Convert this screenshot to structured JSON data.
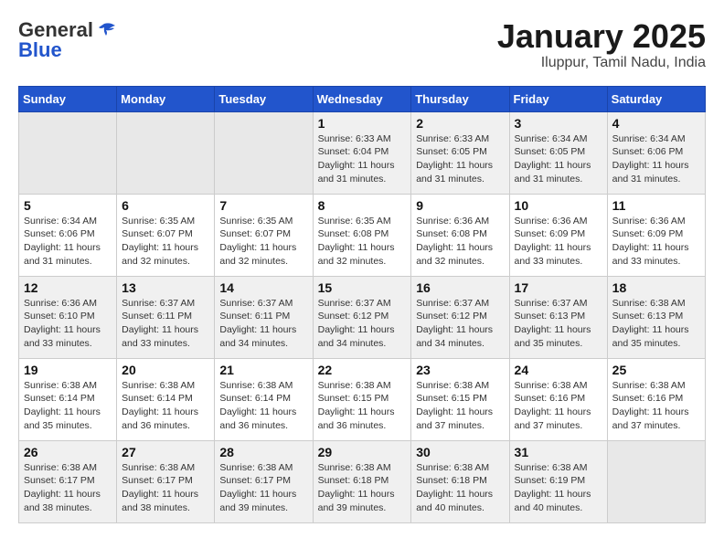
{
  "header": {
    "logo_general": "General",
    "logo_blue": "Blue",
    "month_title": "January 2025",
    "location": "Iluppur, Tamil Nadu, India"
  },
  "weekdays": [
    "Sunday",
    "Monday",
    "Tuesday",
    "Wednesday",
    "Thursday",
    "Friday",
    "Saturday"
  ],
  "weeks": [
    [
      {
        "day": "",
        "empty": true
      },
      {
        "day": "",
        "empty": true
      },
      {
        "day": "",
        "empty": true
      },
      {
        "day": "1",
        "sunrise": "6:33 AM",
        "sunset": "6:04 PM",
        "daylight": "11 hours and 31 minutes."
      },
      {
        "day": "2",
        "sunrise": "6:33 AM",
        "sunset": "6:05 PM",
        "daylight": "11 hours and 31 minutes."
      },
      {
        "day": "3",
        "sunrise": "6:34 AM",
        "sunset": "6:05 PM",
        "daylight": "11 hours and 31 minutes."
      },
      {
        "day": "4",
        "sunrise": "6:34 AM",
        "sunset": "6:06 PM",
        "daylight": "11 hours and 31 minutes."
      }
    ],
    [
      {
        "day": "5",
        "sunrise": "6:34 AM",
        "sunset": "6:06 PM",
        "daylight": "11 hours and 31 minutes."
      },
      {
        "day": "6",
        "sunrise": "6:35 AM",
        "sunset": "6:07 PM",
        "daylight": "11 hours and 32 minutes."
      },
      {
        "day": "7",
        "sunrise": "6:35 AM",
        "sunset": "6:07 PM",
        "daylight": "11 hours and 32 minutes."
      },
      {
        "day": "8",
        "sunrise": "6:35 AM",
        "sunset": "6:08 PM",
        "daylight": "11 hours and 32 minutes."
      },
      {
        "day": "9",
        "sunrise": "6:36 AM",
        "sunset": "6:08 PM",
        "daylight": "11 hours and 32 minutes."
      },
      {
        "day": "10",
        "sunrise": "6:36 AM",
        "sunset": "6:09 PM",
        "daylight": "11 hours and 33 minutes."
      },
      {
        "day": "11",
        "sunrise": "6:36 AM",
        "sunset": "6:09 PM",
        "daylight": "11 hours and 33 minutes."
      }
    ],
    [
      {
        "day": "12",
        "sunrise": "6:36 AM",
        "sunset": "6:10 PM",
        "daylight": "11 hours and 33 minutes."
      },
      {
        "day": "13",
        "sunrise": "6:37 AM",
        "sunset": "6:11 PM",
        "daylight": "11 hours and 33 minutes."
      },
      {
        "day": "14",
        "sunrise": "6:37 AM",
        "sunset": "6:11 PM",
        "daylight": "11 hours and 34 minutes."
      },
      {
        "day": "15",
        "sunrise": "6:37 AM",
        "sunset": "6:12 PM",
        "daylight": "11 hours and 34 minutes."
      },
      {
        "day": "16",
        "sunrise": "6:37 AM",
        "sunset": "6:12 PM",
        "daylight": "11 hours and 34 minutes."
      },
      {
        "day": "17",
        "sunrise": "6:37 AM",
        "sunset": "6:13 PM",
        "daylight": "11 hours and 35 minutes."
      },
      {
        "day": "18",
        "sunrise": "6:38 AM",
        "sunset": "6:13 PM",
        "daylight": "11 hours and 35 minutes."
      }
    ],
    [
      {
        "day": "19",
        "sunrise": "6:38 AM",
        "sunset": "6:14 PM",
        "daylight": "11 hours and 35 minutes."
      },
      {
        "day": "20",
        "sunrise": "6:38 AM",
        "sunset": "6:14 PM",
        "daylight": "11 hours and 36 minutes."
      },
      {
        "day": "21",
        "sunrise": "6:38 AM",
        "sunset": "6:14 PM",
        "daylight": "11 hours and 36 minutes."
      },
      {
        "day": "22",
        "sunrise": "6:38 AM",
        "sunset": "6:15 PM",
        "daylight": "11 hours and 36 minutes."
      },
      {
        "day": "23",
        "sunrise": "6:38 AM",
        "sunset": "6:15 PM",
        "daylight": "11 hours and 37 minutes."
      },
      {
        "day": "24",
        "sunrise": "6:38 AM",
        "sunset": "6:16 PM",
        "daylight": "11 hours and 37 minutes."
      },
      {
        "day": "25",
        "sunrise": "6:38 AM",
        "sunset": "6:16 PM",
        "daylight": "11 hours and 37 minutes."
      }
    ],
    [
      {
        "day": "26",
        "sunrise": "6:38 AM",
        "sunset": "6:17 PM",
        "daylight": "11 hours and 38 minutes."
      },
      {
        "day": "27",
        "sunrise": "6:38 AM",
        "sunset": "6:17 PM",
        "daylight": "11 hours and 38 minutes."
      },
      {
        "day": "28",
        "sunrise": "6:38 AM",
        "sunset": "6:17 PM",
        "daylight": "11 hours and 39 minutes."
      },
      {
        "day": "29",
        "sunrise": "6:38 AM",
        "sunset": "6:18 PM",
        "daylight": "11 hours and 39 minutes."
      },
      {
        "day": "30",
        "sunrise": "6:38 AM",
        "sunset": "6:18 PM",
        "daylight": "11 hours and 40 minutes."
      },
      {
        "day": "31",
        "sunrise": "6:38 AM",
        "sunset": "6:19 PM",
        "daylight": "11 hours and 40 minutes."
      },
      {
        "day": "",
        "empty": true
      }
    ]
  ]
}
